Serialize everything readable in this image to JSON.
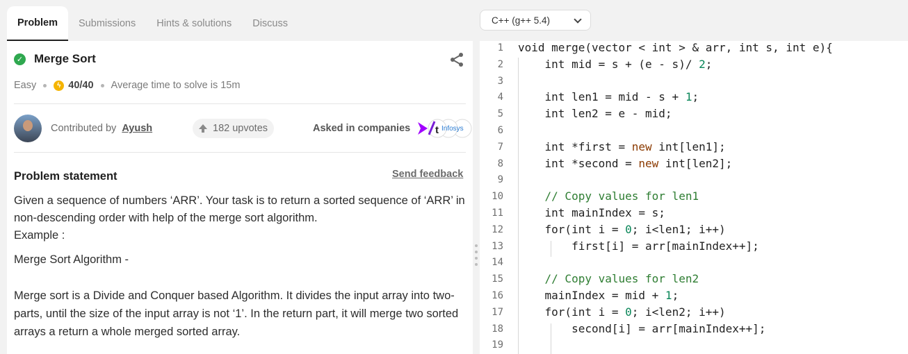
{
  "tabs": [
    {
      "label": "Problem",
      "active": true
    },
    {
      "label": "Submissions",
      "active": false
    },
    {
      "label": "Hints & solutions",
      "active": false
    },
    {
      "label": "Discuss",
      "active": false
    }
  ],
  "problem": {
    "title": "Merge Sort",
    "difficulty": "Easy",
    "points": "40/40",
    "avg_time": "Average time to solve is 15m"
  },
  "contributor": {
    "prefix": "Contributed by",
    "name": "Ayush",
    "upvotes": "182 upvotes",
    "asked_label": "Asked in companies",
    "company_logo_text": "Infosys"
  },
  "statement": {
    "heading": "Problem statement",
    "feedback": "Send feedback",
    "p1": "Given a sequence of numbers ‘ARR’. Your task is to return a sorted sequence of ‘ARR’ in non-descending order with help of the merge sort algorithm.",
    "p1b": "Example :",
    "p2": "Merge Sort Algorithm -",
    "p3": "Merge sort is a Divide and Conquer based Algorithm. It divides the input array into two-parts, until the size of the input array is not ‘1’. In the return part, it will merge two sorted arrays a return a whole merged sorted array."
  },
  "editor": {
    "language": "C++ (g++ 5.4)",
    "lines": [
      "void merge(vector < int > & arr, int s, int e){",
      "    int mid = s + (e - s)/ 2;",
      "",
      "    int len1 = mid - s + 1;",
      "    int len2 = e - mid;",
      "",
      "    int *first = new int[len1];",
      "    int *second = new int[len2];",
      "",
      "    // Copy values for len1",
      "    int mainIndex = s;",
      "    for(int i = 0; i<len1; i++)",
      "        first[i] = arr[mainIndex++];",
      "",
      "    // Copy values for len2",
      "    mainIndex = mid + 1;",
      "    for(int i = 0; i<len2; i++)",
      "        second[i] = arr[mainIndex++];",
      ""
    ]
  },
  "colors": {
    "accent_green": "#2fa84f",
    "bolt_yellow": "#f5b400",
    "number_green": "#098658",
    "new_keyword": "#8b3a00",
    "comment_green": "#2e7d32"
  }
}
